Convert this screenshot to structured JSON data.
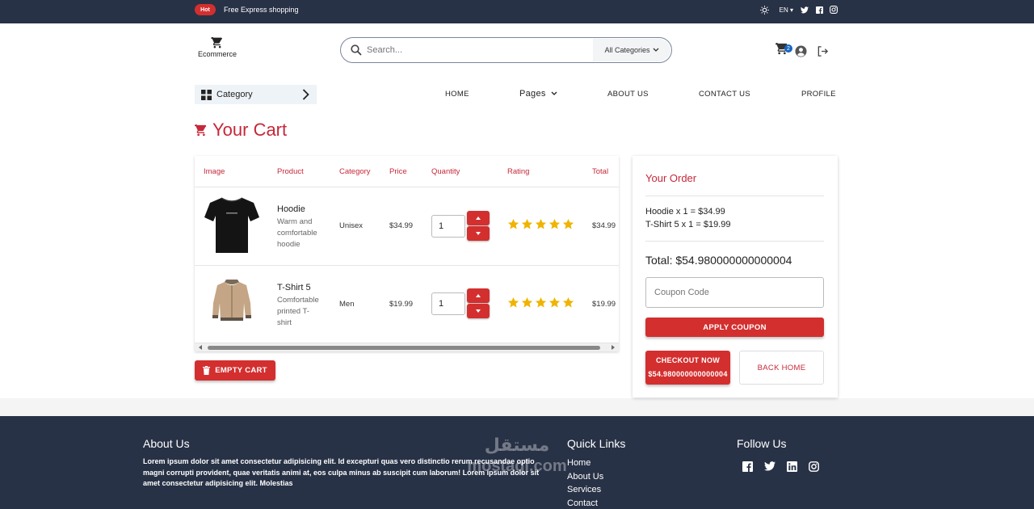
{
  "topbar": {
    "badge": "Hot",
    "promo": "Free Express shopping",
    "language": "EN"
  },
  "header": {
    "logo_text": "Ecommerce",
    "search_placeholder": "Search...",
    "categories_select": "All Categories",
    "cart_count": "2"
  },
  "nav": {
    "category_button": "Category",
    "items": [
      "HOME",
      "Pages",
      "ABOUT US",
      "CONTACT US",
      "PROFILE"
    ]
  },
  "page_title": "Your Cart",
  "table": {
    "headers": [
      "Image",
      "Product",
      "Category",
      "Price",
      "Quantity",
      "Rating",
      "Total"
    ],
    "rows": [
      {
        "name": "Hoodie",
        "desc1": "Warm and",
        "desc2": "comfortable",
        "desc3": "hoodie",
        "category": "Unisex",
        "price": "$34.99",
        "quantity": "1",
        "rating": 5,
        "total": "$34.99"
      },
      {
        "name": "T-Shirt 5",
        "desc1": "Comfortable",
        "desc2": "printed T-",
        "desc3": "shirt",
        "category": "Men",
        "price": "$19.99",
        "quantity": "1",
        "rating": 5,
        "total": "$19.99"
      }
    ]
  },
  "empty_cart_label": "EMPTY CART",
  "order": {
    "title": "Your Order",
    "lines": [
      "Hoodie x 1 = $34.99",
      "T-Shirt 5 x 1 = $19.99"
    ],
    "total": "Total: $54.980000000000004",
    "coupon_placeholder": "Coupon Code",
    "apply_label": "APPLY COUPON",
    "checkout_label": "CHECKOUT NOW",
    "checkout_amount": "$54.980000000000004",
    "back_label": "BACK HOME"
  },
  "footer": {
    "about_title": "About Us",
    "about_text": "Lorem ipsum dolor sit amet consectetur adipisicing elit. Id excepturi quas vero distinctio rerum recusandae optio magni corrupti provident, quae veritatis animi at, eos culpa minus ab suscipit cum laborum! Lorem ipsum dolor sit amet consectetur adipisicing elit. Molestias",
    "links_title": "Quick Links",
    "links": [
      "Home",
      "About Us",
      "Services",
      "Contact"
    ],
    "follow_title": "Follow Us"
  },
  "watermark": {
    "line1": "مستقل",
    "line2": "mostaql.com"
  },
  "colors": {
    "accent": "#d32f2f",
    "accent_text": "#c62839",
    "dark": "#283246",
    "star": "#f0b400"
  }
}
